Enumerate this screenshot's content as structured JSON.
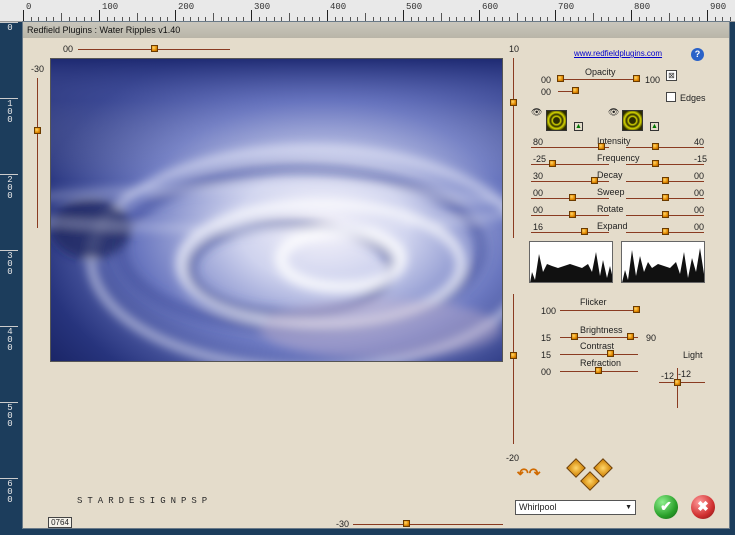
{
  "ruler": {
    "top_labels": [
      "0",
      "100",
      "200",
      "300",
      "400",
      "500",
      "600",
      "700",
      "800",
      "900"
    ],
    "left_labels": [
      [
        "0"
      ],
      [
        "1",
        "0",
        "0"
      ],
      [
        "2",
        "0",
        "0"
      ],
      [
        "3",
        "0",
        "0"
      ],
      [
        "4",
        "0",
        "0"
      ],
      [
        "5",
        "0",
        "0"
      ],
      [
        "6",
        "0",
        "0"
      ]
    ]
  },
  "dialog": {
    "title": "Redfield Plugins : Water Ripples v1.40",
    "url": "www.redfieldplugins.com",
    "help_glyph": "?",
    "top_slider_value": "00",
    "left_slider_value": "-30",
    "right_slider_top_value": "10",
    "right_slider_bottom_value": "-20",
    "bottom_slider_value": "-30",
    "coord_box": "0764",
    "watermark": "STARDESIGNPSP"
  },
  "opacity": {
    "label": "Opacity",
    "min": "00",
    "max": "100",
    "second": "00"
  },
  "edges": {
    "label": "Edges"
  },
  "params": [
    {
      "label": "Intensity",
      "left": "80",
      "right": "40"
    },
    {
      "label": "Frequency",
      "left": "-25",
      "right": "-15"
    },
    {
      "label": "Decay",
      "left": "30",
      "right": "00"
    },
    {
      "label": "Sweep",
      "left": "00",
      "right": "00"
    },
    {
      "label": "Rotate",
      "left": "00",
      "right": "00"
    },
    {
      "label": "Expand",
      "left": "16",
      "right": "00"
    }
  ],
  "lighting": {
    "flicker_label": "Flicker",
    "flicker_value": "100",
    "brightness_label": "Brightness",
    "brightness_value": "15",
    "brightness_right": "90",
    "contrast_label": "Contrast",
    "contrast_value": "15",
    "refraction_label": "Refraction",
    "refraction_value": "00",
    "light_label": "Light",
    "light_x": "-12",
    "light_y": "-12"
  },
  "preset": {
    "selected": "Whirlpool"
  },
  "colors": {
    "accent": "#e38a00",
    "track": "#8a3b21",
    "ok": "#2aa02a",
    "cancel": "#d03030",
    "dialog_bg": "#e4dccb"
  }
}
